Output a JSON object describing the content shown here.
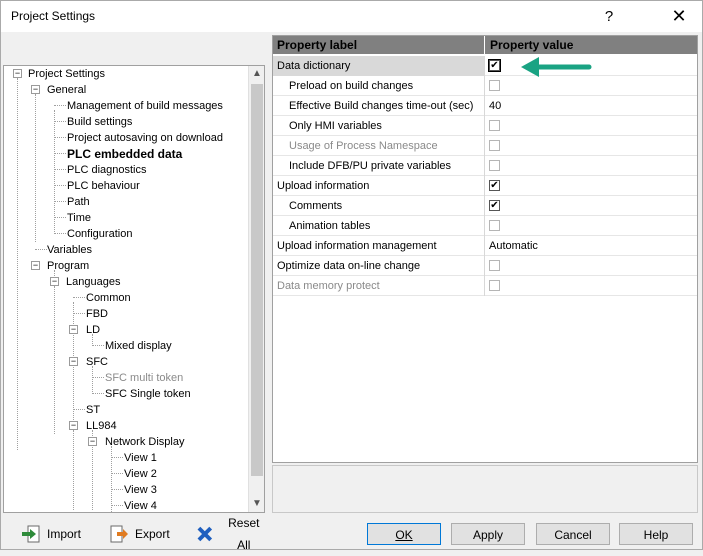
{
  "window": {
    "title": "Project Settings",
    "help_glyph": "?",
    "close_glyph": "✕"
  },
  "tree": {
    "root": "Project Settings",
    "general": "General",
    "management_build_messages": "Management of build messages",
    "build_settings": "Build settings",
    "project_autosaving": "Project autosaving on download",
    "plc_embedded_data": "PLC embedded data",
    "plc_diagnostics": "PLC diagnostics",
    "plc_behaviour": "PLC behaviour",
    "path": "Path",
    "time": "Time",
    "configuration": "Configuration",
    "variables": "Variables",
    "program": "Program",
    "languages": "Languages",
    "common": "Common",
    "fbd": "FBD",
    "ld": "LD",
    "mixed_display": "Mixed display",
    "sfc": "SFC",
    "sfc_multi_token": "SFC multi token",
    "sfc_single_token": "SFC Single token",
    "st": "ST",
    "ll984": "LL984",
    "network_display": "Network Display",
    "view1": "View 1",
    "view2": "View 2",
    "view3": "View 3",
    "view4": "View 4"
  },
  "grid": {
    "col_label": "Property label",
    "col_value": "Property value",
    "rows": [
      {
        "label": "Data dictionary",
        "check": "✔",
        "text": ""
      },
      {
        "label": "Preload on build changes",
        "check": "",
        "text": ""
      },
      {
        "label": "Effective Build changes time-out (sec)",
        "check": "",
        "text": "40"
      },
      {
        "label": "Only HMI variables",
        "check": "",
        "text": ""
      },
      {
        "label": "Usage of Process Namespace",
        "check": "",
        "text": ""
      },
      {
        "label": "Include DFB/PU private variables",
        "check": "",
        "text": ""
      },
      {
        "label": "Upload information",
        "check": "✔",
        "text": ""
      },
      {
        "label": "Comments",
        "check": "✔",
        "text": ""
      },
      {
        "label": "Animation tables",
        "check": "",
        "text": ""
      },
      {
        "label": "Upload information management",
        "check": "",
        "text": "Automatic"
      },
      {
        "label": "Optimize data on-line change",
        "check": "",
        "text": ""
      },
      {
        "label": "Data memory protect",
        "check": "",
        "text": ""
      }
    ]
  },
  "buttons": {
    "import": "Import",
    "export": "Export",
    "reset_all": "Reset All",
    "ok": "OK",
    "apply": "Apply",
    "cancel": "Cancel",
    "help": "Help"
  },
  "colors": {
    "arrow": "#1aa383",
    "header_bg": "#808080",
    "selected_row": "#d9d9d9",
    "disabled_text": "#8a8a8a"
  },
  "icons": {
    "import": "import-icon",
    "export": "export-icon",
    "reset": "reset-x-icon",
    "pointer": "arrow-left-icon"
  }
}
